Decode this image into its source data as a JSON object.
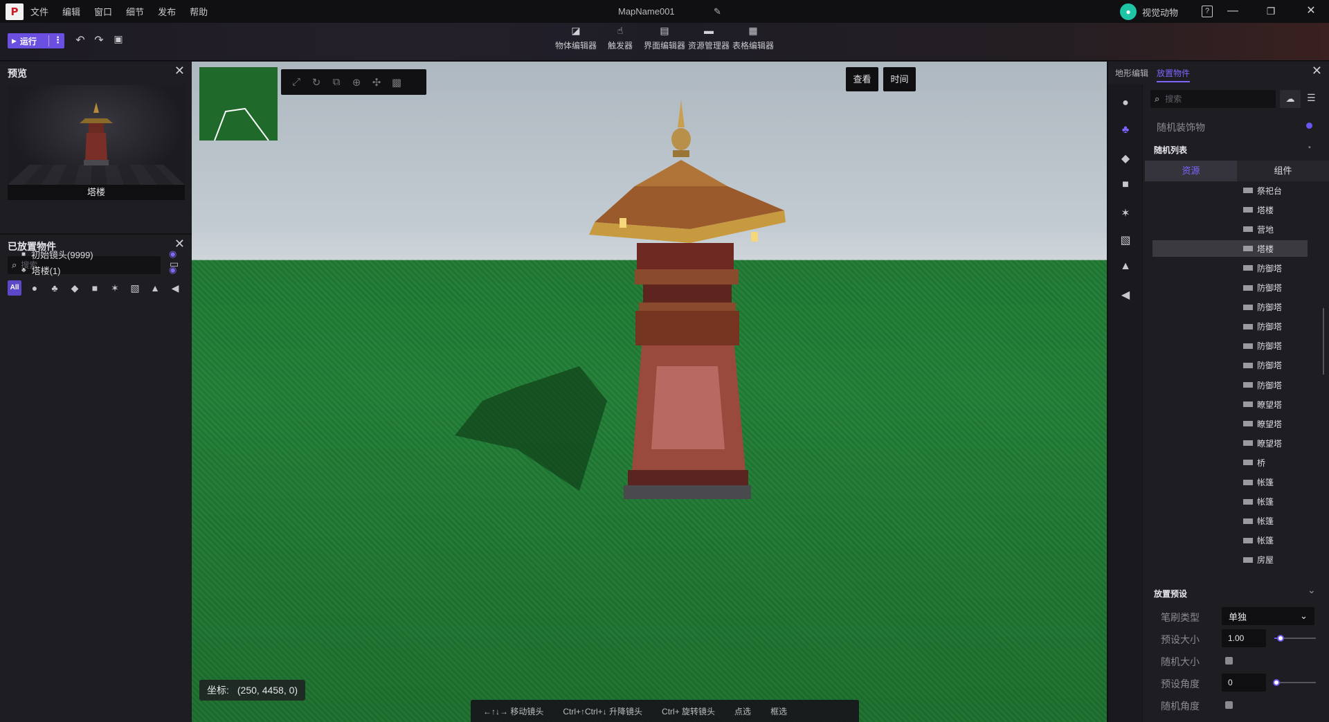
{
  "titlebar": {
    "logo": "☰",
    "menu": [
      "文件",
      "编辑",
      "窗口",
      "细节",
      "发布",
      "帮助"
    ],
    "map_name": "MapName001",
    "user_name": "视觉动物",
    "help": "?"
  },
  "toolbar": {
    "run_label": "运行",
    "editors": [
      "物体编辑器",
      "触发器",
      "界面编辑器",
      "资源管理器",
      "表格编辑器"
    ]
  },
  "preview_panel": {
    "title": "预览",
    "caption": "塔楼"
  },
  "placed_panel": {
    "title": "已放置物件",
    "search_placeholder": "搜索",
    "filter_all": "All",
    "items": [
      {
        "label": "初始镜头(9999)",
        "icon": "camera-icon"
      },
      {
        "label": "塔楼(1)",
        "icon": "tree-icon"
      }
    ]
  },
  "viewport": {
    "buttons": [
      "查看",
      "时间"
    ],
    "coord_label": "坐标:",
    "coord_value": "(250, 4458, 0)",
    "hints": [
      "←↑↓→ 移动镜头",
      "Ctrl+↑Ctrl+↓ 升降镜头",
      "Ctrl+ 旋转镜头",
      "点选",
      "框选"
    ]
  },
  "right_panel": {
    "tabs": [
      "地形编辑",
      "放置物件"
    ],
    "active_tab": "放置物件",
    "search_placeholder": "搜索",
    "random_decor": "随机装饰物",
    "random_list": "随机列表",
    "res_tabs": [
      "资源",
      "组件"
    ],
    "assets": [
      "祭祀台",
      "塔楼",
      "营地",
      "塔楼",
      "防御塔",
      "防御塔",
      "防御塔",
      "防御塔",
      "防御塔",
      "防御塔",
      "防御塔",
      "瞭望塔",
      "瞭望塔",
      "瞭望塔",
      "桥",
      "帐篷",
      "帐篷",
      "帐篷",
      "帐篷",
      "房屋"
    ],
    "selected_asset_index": 3,
    "preset": {
      "title": "放置预设",
      "brush_type_label": "笔刷类型",
      "brush_type_value": "单独",
      "preset_size_label": "预设大小",
      "preset_size_value": "1.00",
      "random_size_label": "随机大小",
      "preset_angle_label": "预设角度",
      "preset_angle_value": "0",
      "random_angle_label": "随机角度"
    }
  },
  "colors": {
    "accent": "#6b4fe0",
    "accent_text": "#7c66ff",
    "grass": "#217e36",
    "sky": "#c3cbd2",
    "panel": "#1e1e22"
  }
}
